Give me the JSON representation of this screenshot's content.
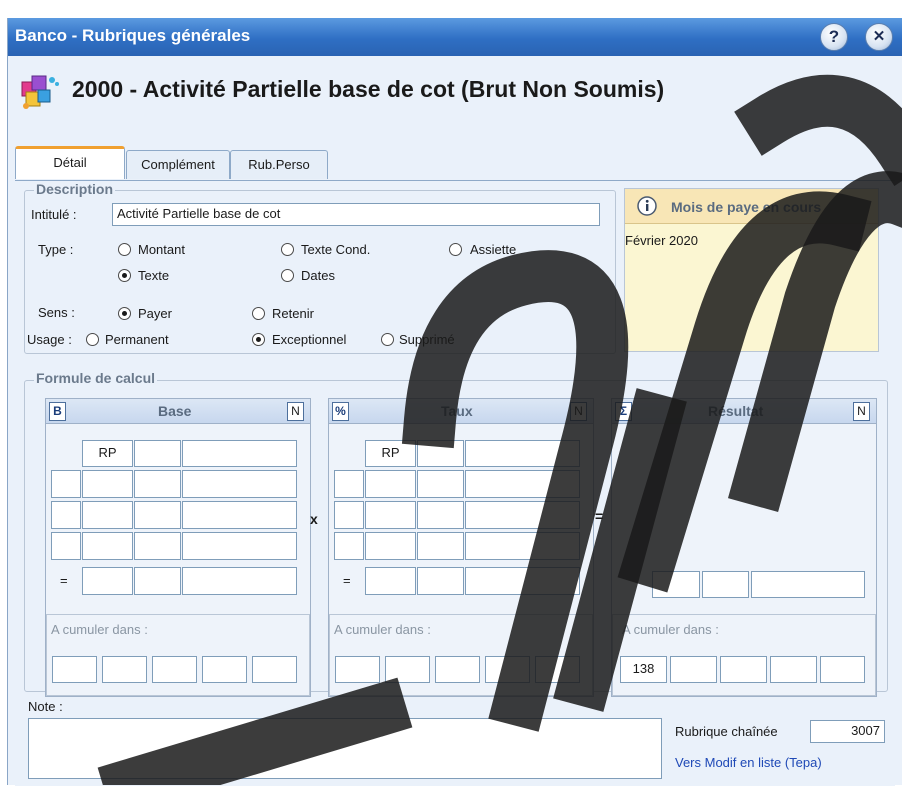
{
  "window": {
    "title": "Banco - Rubriques générales",
    "help_glyph": "?",
    "close_glyph": "✕"
  },
  "header": {
    "title": "2000 - Activité Partielle base de cot (Brut Non Soumis)",
    "icon": "rubrique-blocks-icon"
  },
  "tabs": [
    {
      "label": "Détail",
      "active": true
    },
    {
      "label": "Complément",
      "active": false
    },
    {
      "label": "Rub.Perso",
      "active": false
    }
  ],
  "description": {
    "legend": "Description",
    "intitule_label": "Intitulé :",
    "intitule_value": "Activité Partielle base de cot",
    "type_label": "Type :",
    "type_options": [
      {
        "label": "Montant",
        "selected": false
      },
      {
        "label": "Texte Cond.",
        "selected": false
      },
      {
        "label": "Assiette",
        "selected": false
      },
      {
        "label": "Texte",
        "selected": true
      },
      {
        "label": "Dates",
        "selected": false
      }
    ],
    "sens_label": "Sens :",
    "sens_options": [
      {
        "label": "Payer",
        "selected": true
      },
      {
        "label": "Retenir",
        "selected": false
      }
    ],
    "usage_label": "Usage :",
    "usage_options": [
      {
        "label": "Permanent",
        "selected": false
      },
      {
        "label": "Exceptionnel",
        "selected": true
      },
      {
        "label": "Supprimé",
        "selected": false
      }
    ]
  },
  "info": {
    "title": "Mois de paye en cours",
    "value": "Février 2020",
    "icon": "info-icon"
  },
  "formule": {
    "legend": "Formule de calcul",
    "multiply_sign": "x",
    "equals_sign": "=",
    "base": {
      "badge": "B",
      "title": "Base",
      "n_button": "N",
      "rp": "RP",
      "eq": "=",
      "cumul_label": "A cumuler dans :"
    },
    "taux": {
      "badge": "%",
      "title": "Taux",
      "n_button": "N",
      "rp": "RP",
      "eq": "=",
      "cumul_label": "A cumuler dans :"
    },
    "resultat": {
      "badge": "Σ",
      "title": "Résultat",
      "n_button": "N",
      "cumul_label": "A cumuler dans :",
      "cumul_first_value": "138"
    }
  },
  "note": {
    "label": "Note :",
    "value": ""
  },
  "rubrique_chainee": {
    "label": "Rubrique chaînée",
    "value": "3007"
  },
  "link": {
    "label": "Vers Modif en liste (Tepa)"
  },
  "colors": {
    "titlebar": "#2f6fc4",
    "accent_tab": "#f0a030",
    "info_bg": "#fbf6d2",
    "link": "#1f49b6"
  }
}
